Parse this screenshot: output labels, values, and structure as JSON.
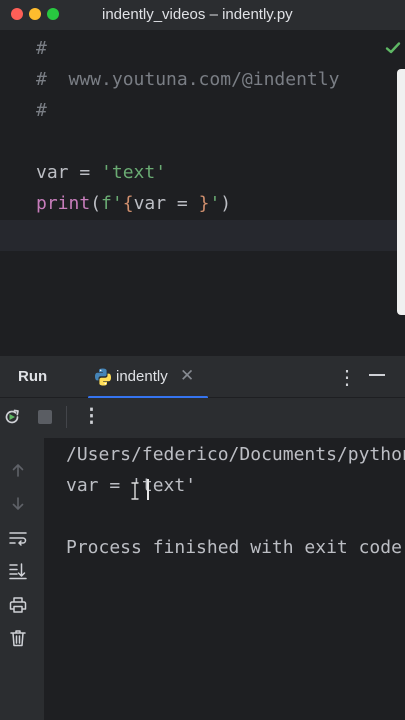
{
  "window": {
    "title": "indently_videos – indently.py"
  },
  "editor": {
    "lines": {
      "c1": "#",
      "c2": "#  www.youtuna.com/@indently",
      "c3": "#",
      "l5": {
        "var": "var",
        "eq": " = ",
        "str": "'text'"
      },
      "l6": {
        "print": "print",
        "p_open": "(",
        "f_open": "f'",
        "brace_open": "{",
        "inner": "var = ",
        "brace_close": "}",
        "f_close": "'",
        "p_close": ")"
      }
    },
    "status_icon": "check-icon",
    "accent_check": "#5fb865"
  },
  "tool_window": {
    "title": "Run",
    "tab": {
      "label": "indently",
      "icon": "python-icon",
      "close_glyph": "✕"
    },
    "more_glyph": "⋮",
    "hide_icon": "minimize-icon"
  },
  "run_toolbar": {
    "icons": [
      "rerun-icon",
      "stop-icon",
      "more-icon"
    ]
  },
  "side_rail": {
    "icons": [
      "arrow-up-icon",
      "arrow-down-icon",
      "soft-wrap-icon",
      "scroll-to-end-icon",
      "print-icon",
      "trash-icon"
    ]
  },
  "console": {
    "lines": [
      "/Users/federico/Documents/python",
      "var = 'text'",
      "",
      "Process finished with exit code"
    ]
  },
  "colors": {
    "accent": "#3574f0",
    "string": "#6aab73",
    "builtin": "#c77dbb",
    "brace": "#cf8e6d",
    "comment": "#7a7e85"
  }
}
